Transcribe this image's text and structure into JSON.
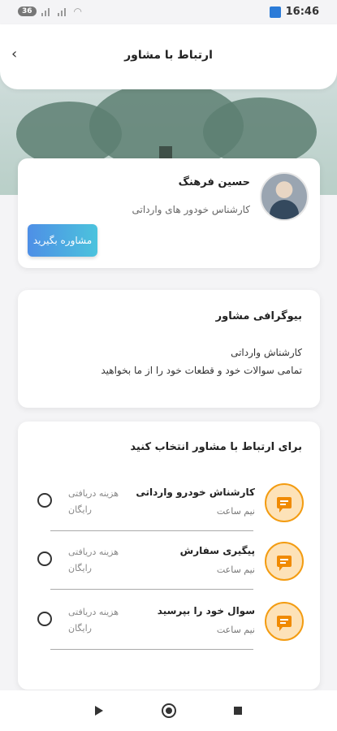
{
  "status_bar": {
    "battery_badge": "36",
    "time": "16:46"
  },
  "header": {
    "title": "ارتباط با مشاور",
    "back_icon": "chevron-left-icon"
  },
  "advisor": {
    "name": "حسین فرهنگ",
    "role": "کارشناس خودور های وارداتی",
    "consult_button": "مشاوره بگیرید"
  },
  "bio": {
    "title": "بیوگرافی مشاور",
    "line1": "کارشناش وارداتی",
    "line2": "تمامی سوالات خود و قطعات خود را از ما بخواهید"
  },
  "select": {
    "title": "برای ارتباط با مشاور انتخاب کنید",
    "options": [
      {
        "name": "کارشناش خودرو وارداتی",
        "duration": "نیم ساعت",
        "cost_label": "هزینه دریافتی",
        "cost_value": "رایگان",
        "selected": false
      },
      {
        "name": "پیگیری سفارش",
        "duration": "نیم ساعت",
        "cost_label": "هزینه دریافتی",
        "cost_value": "رایگان",
        "selected": false
      },
      {
        "name": "سوال خود را بپرسید",
        "duration": "نیم ساعت",
        "cost_label": "هزینه دریافتی",
        "cost_value": "رایگان",
        "selected": false
      }
    ]
  },
  "colors": {
    "accent_orange": "#f39c12",
    "button_gradient_start": "#4e8fe6",
    "button_gradient_end": "#4bc3dd"
  }
}
